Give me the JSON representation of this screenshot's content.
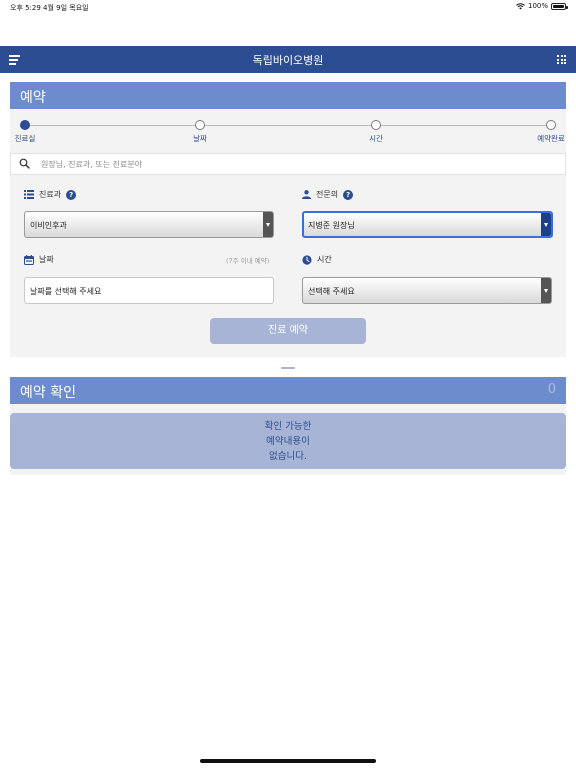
{
  "status_bar": {
    "time_date": "오후 5:29   4월 9일 목요일",
    "battery": "100%"
  },
  "header": {
    "title": "독립바이오병원"
  },
  "reservation": {
    "title": "예약",
    "steps": [
      {
        "label": "진료실",
        "active": true
      },
      {
        "label": "날짜",
        "active": false
      },
      {
        "label": "시간",
        "active": false
      },
      {
        "label": "예약완료",
        "active": false
      }
    ],
    "search": {
      "placeholder": "원장님, 진료과, 또는 진료분야",
      "value": ""
    },
    "department": {
      "label": "진료과",
      "help": "?",
      "selected": "이비인후과"
    },
    "doctor": {
      "label": "전문의",
      "help": "?",
      "selected": "지병준 원장님"
    },
    "date": {
      "label": "날짜",
      "hint": "(7주 이내 예약)",
      "value": "날짜를 선택해 주세요"
    },
    "time": {
      "label": "시간",
      "selected": "선택해 주세요"
    },
    "submit_label": "진료 예약"
  },
  "confirmation": {
    "title": "예약 확인",
    "count": "0",
    "empty_lines": [
      "확인 가능한",
      "예약내용이",
      "없습니다."
    ]
  },
  "colors": {
    "header_bg": "#2c4d92",
    "panel_header_bg": "#6d8ccd",
    "accent": "#2c4d92",
    "button_bg": "#a7b4d6",
    "panel_bg": "#f3f3f3"
  }
}
